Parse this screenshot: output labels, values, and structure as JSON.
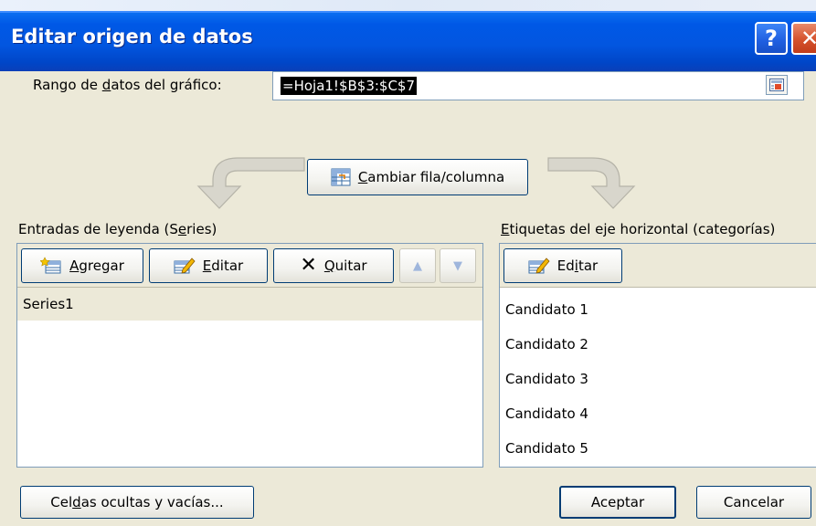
{
  "dialog": {
    "title": "Editar origen de datos",
    "help_glyph": "?",
    "close_glyph": "✕"
  },
  "range": {
    "label_pre": "Rango de ",
    "label_hot": "d",
    "label_post": "atos del gráfico:",
    "value": "=Hoja1!$B$3:$C$7"
  },
  "switch_button": {
    "hot": "C",
    "rest": "ambiar fila/columna"
  },
  "legend": {
    "heading_pre": "Entradas de leyenda (S",
    "heading_hot": "e",
    "heading_post": "ries)",
    "add_hot": "A",
    "add_rest": "gregar",
    "edit_hot": "E",
    "edit_rest": "ditar",
    "remove_hot": "Q",
    "remove_rest": "uitar",
    "series": [
      "Series1"
    ]
  },
  "categories": {
    "heading_pre": "",
    "heading_hot": "E",
    "heading_post": "tiquetas del eje horizontal (categorías)",
    "edit_pre": "Ed",
    "edit_hot": "i",
    "edit_post": "tar",
    "items": [
      "Candidato 1",
      "Candidato 2",
      "Candidato 3",
      "Candidato 4",
      "Candidato 5"
    ]
  },
  "footer": {
    "hidden_pre": "Cel",
    "hidden_hot": "d",
    "hidden_post": "as ocultas y vacías...",
    "ok": "Aceptar",
    "cancel": "Cancelar"
  },
  "colors": {
    "titlebar": "#0256e0",
    "dialog_bg": "#ece9d8",
    "button_border": "#003c74",
    "panel_border": "#7f9db9"
  }
}
